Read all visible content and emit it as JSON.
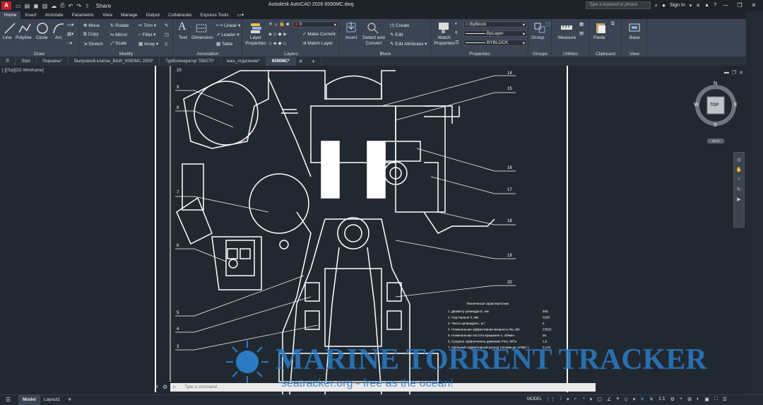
{
  "app": {
    "logo": "A",
    "title": "Autodesk AutoCAD 2026    6590MC.dwg",
    "share": "Share",
    "search_placeholder": "Type a keyword or phrase",
    "signin": "Sign In"
  },
  "ribbon_tabs": [
    "Home",
    "Insert",
    "Annotate",
    "Parametric",
    "View",
    "Manage",
    "Output",
    "Collaborate",
    "Express Tools"
  ],
  "draw": {
    "title": "Draw",
    "line": "Line",
    "polyline": "Polyline",
    "circle": "Circle",
    "arc": "Arc"
  },
  "modify": {
    "title": "Modify",
    "move": "Move",
    "rotate": "Rotate",
    "trim": "Trim",
    "copy": "Copy",
    "mirror": "Mirror",
    "fillet": "Fillet",
    "stretch": "Stretch",
    "scale": "Scale",
    "array": "Array"
  },
  "annotation": {
    "title": "Annotation",
    "text": "Text",
    "dimension": "Dimension",
    "linear": "Linear",
    "leader": "Leader",
    "table": "Table"
  },
  "layers": {
    "title": "Layers",
    "layer_props": "Layer Properties",
    "current_layer": "0",
    "make_current": "Make Current",
    "match_layer": "Match Layer"
  },
  "block": {
    "title": "Block",
    "insert": "Insert",
    "detect_convert": "Detect and Convert",
    "create": "Create",
    "edit": "Edit",
    "edit_attributes": "Edit Attributes"
  },
  "properties": {
    "title": "Properties",
    "match": "Match Properties",
    "color": "ByBlock",
    "linetype": "ByLayer",
    "lineweight": "BYBLOCK"
  },
  "groups": {
    "title": "Groups",
    "group": "Group"
  },
  "utilities": {
    "title": "Utilities",
    "measure": "Measure"
  },
  "clipboard": {
    "title": "Clipboard",
    "paste": "Paste"
  },
  "view": {
    "title": "View",
    "base": "Base"
  },
  "doc_tabs": [
    "Start",
    "Поршень*",
    "Выпускной клапан_B&W_6S50MC 2000*",
    "Турбогенератор ТВ8270*",
    "маш_отделение*",
    "6590MC*"
  ],
  "viewport_label": "[-][Top][2D Wireframe]",
  "viewcube": {
    "n": "N",
    "s": "S",
    "e": "E",
    "w": "W",
    "face": "TOP",
    "wcs": "WCS"
  },
  "callouts": [
    "14",
    "15",
    "16",
    "17",
    "18",
    "19",
    "20",
    "9",
    "8",
    "7",
    "6",
    "5",
    "4",
    "3",
    "10"
  ],
  "tech": {
    "title": "Техническая характеристика",
    "rows": [
      {
        "label": "1. Диаметр цилиндра D, мм",
        "value": "500"
      },
      {
        "label": "2. Ход поршня S, мм",
        "value": "3190"
      },
      {
        "label": "3. Число цилиндров i, шт",
        "value": "6"
      },
      {
        "label": "4. Номинальная эффективная мощность Nе, кВт",
        "value": "23520"
      },
      {
        "label": "5. Номинальная частота вращения n, об/мин",
        "value": "55"
      },
      {
        "label": "6. Среднее эффективное давление Pme, МПа",
        "value": "1,9"
      },
      {
        "label": "7. Удельный эффективный расход топлива ge, кг/кВт·ч",
        "value": "0,170"
      }
    ]
  },
  "command_placeholder": "Type a command",
  "layout_tabs": [
    "Model",
    "Layout1"
  ],
  "status": {
    "model": "MODEL",
    "scale": "1:1"
  },
  "watermark": {
    "title": "MARINE TORRENT TRACKER",
    "sub": "seatracker.org - free as the ocean!"
  },
  "colors": {
    "ribbon": "#3b4453",
    "canvas": "#212830",
    "accent": "#c41f2b",
    "watermark": "#2a7bc4"
  }
}
